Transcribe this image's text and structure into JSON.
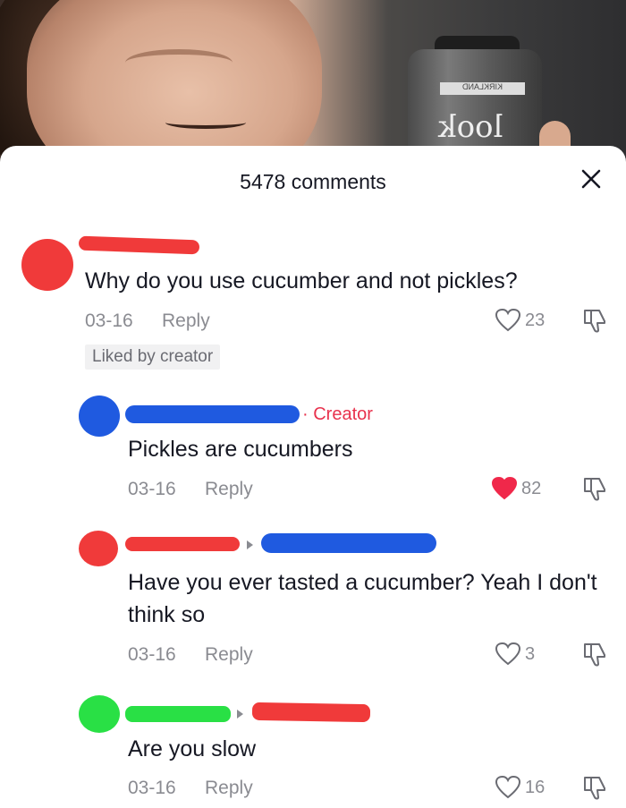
{
  "sheet": {
    "title": "5478 comments"
  },
  "comments": [
    {
      "text": "Why do you use cucumber and not pickles?",
      "date": "03-16",
      "reply_label": "Reply",
      "likes": "23",
      "liked": false,
      "badge": "Liked by creator",
      "avatar_color": "#f03a3a"
    },
    {
      "text": "Pickles are cucumbers",
      "date": "03-16",
      "reply_label": "Reply",
      "likes": "82",
      "liked": true,
      "creator_tag": "· Creator",
      "avatar_color": "#1f5ae0"
    },
    {
      "text": "Have you ever tasted a cucumber? Yeah I don't think so",
      "date": "03-16",
      "reply_label": "Reply",
      "likes": "3",
      "liked": false,
      "avatar_color": "#f03a3a"
    },
    {
      "text": "Are you slow",
      "date": "03-16",
      "reply_label": "Reply",
      "likes": "16",
      "liked": false,
      "avatar_color": "#29e045"
    }
  ],
  "colors": {
    "redaction_red": "#f03a3a",
    "redaction_blue": "#1f5ae0",
    "redaction_green": "#29e045",
    "liked_heart": "#f0284a"
  },
  "icons": [
    "close-icon",
    "heart-icon",
    "dislike-icon",
    "reply-arrow-icon"
  ]
}
